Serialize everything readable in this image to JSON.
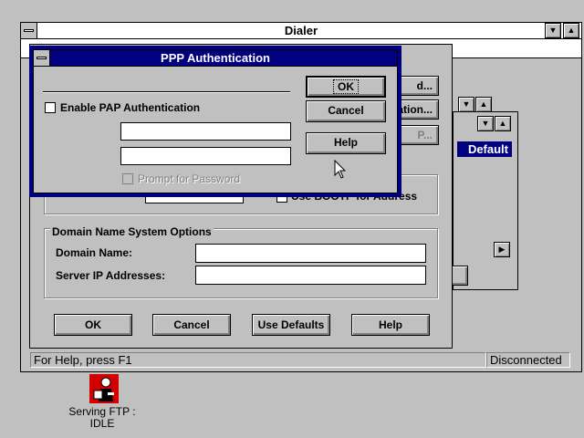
{
  "dialer": {
    "title": "Dialer",
    "status_help": "For Help, press F1",
    "status_connection": "Disconnected"
  },
  "background_window": {
    "partial_button_1": "d...",
    "partial_button_2": "ation...",
    "partial_button_3": "P...",
    "list_header": "Default",
    "partial_row_label": "",
    "partial_checkbox_label": "Use BOOTP for Address"
  },
  "dns": {
    "group_label": "Domain Name System Options",
    "domain_name_label": "Domain Name:",
    "domain_name_value": "",
    "server_ip_label": "Server IP Addresses:",
    "server_ip_value": ""
  },
  "setup_buttons": {
    "ok": "OK",
    "cancel": "Cancel",
    "use_defaults": "Use Defaults",
    "help": "Help"
  },
  "ppp_dialog": {
    "title": "PPP Authentication",
    "enable_pap_label": "Enable PAP Authentication",
    "enable_pap_checked": false,
    "field_1_value": "",
    "field_2_value": "",
    "prompt_password_label": "Prompt for Password",
    "prompt_password_checked": false,
    "ok": "OK",
    "cancel": "Cancel",
    "help": "Help"
  },
  "desktop_icon": {
    "label_line1": "Serving FTP :",
    "label_line2": "IDLE",
    "icon": "ftp-server-icon"
  }
}
